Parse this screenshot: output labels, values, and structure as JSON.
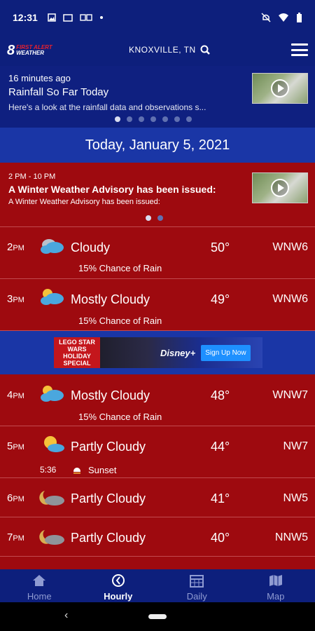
{
  "status_bar": {
    "time": "12:31"
  },
  "header": {
    "location": "KNOXVILLE, TN",
    "logo_number": "8",
    "logo_line1": "FIRST ALERT",
    "logo_line2": "WEATHER"
  },
  "news": {
    "meta": "16 minutes ago",
    "title": "Rainfall So Far Today",
    "description": "Here's a look at the rainfall data and observations s..."
  },
  "date_bar": "Today, January 5, 2021",
  "alert": {
    "time": "2 PM - 10 PM",
    "title": "A Winter Weather Advisory has been issued:",
    "description": "A Winter Weather Advisory has been issued:"
  },
  "hours": [
    {
      "hour": "2",
      "ampm": "PM",
      "condition": "Cloudy",
      "temp": "50°",
      "wind": "WNW6",
      "rain": "15% Chance of Rain",
      "icon": "cloudy-rain-icon"
    },
    {
      "hour": "3",
      "ampm": "PM",
      "condition": "Mostly Cloudy",
      "temp": "49°",
      "wind": "WNW6",
      "rain": "15% Chance of Rain",
      "icon": "mostly-cloudy-icon"
    },
    {
      "hour": "4",
      "ampm": "PM",
      "condition": "Mostly Cloudy",
      "temp": "48°",
      "wind": "WNW7",
      "rain": "15% Chance of Rain",
      "icon": "mostly-cloudy-icon"
    },
    {
      "hour": "5",
      "ampm": "PM",
      "condition": "Partly Cloudy",
      "temp": "44°",
      "wind": "NW7",
      "sunset_time": "5:36",
      "sunset_label": "Sunset",
      "icon": "partly-cloudy-icon"
    },
    {
      "hour": "6",
      "ampm": "PM",
      "condition": "Partly Cloudy",
      "temp": "41°",
      "wind": "NW5",
      "icon": "partly-cloudy-night-icon"
    },
    {
      "hour": "7",
      "ampm": "PM",
      "condition": "Partly Cloudy",
      "temp": "40°",
      "wind": "NNW5",
      "icon": "partly-cloudy-night-icon"
    }
  ],
  "ad": {
    "left_text": "LEGO STAR WARS HOLIDAY SPECIAL",
    "brand": "Disney+",
    "cta": "Sign Up Now"
  },
  "tabs": [
    {
      "label": "Home",
      "icon": "home-icon"
    },
    {
      "label": "Hourly",
      "icon": "clock-icon"
    },
    {
      "label": "Daily",
      "icon": "calendar-icon"
    },
    {
      "label": "Map",
      "icon": "map-icon"
    }
  ],
  "colors": {
    "primary": "#0d1f7c",
    "alert_bg": "#9e0a0f",
    "date_bar": "#1a36a6"
  }
}
